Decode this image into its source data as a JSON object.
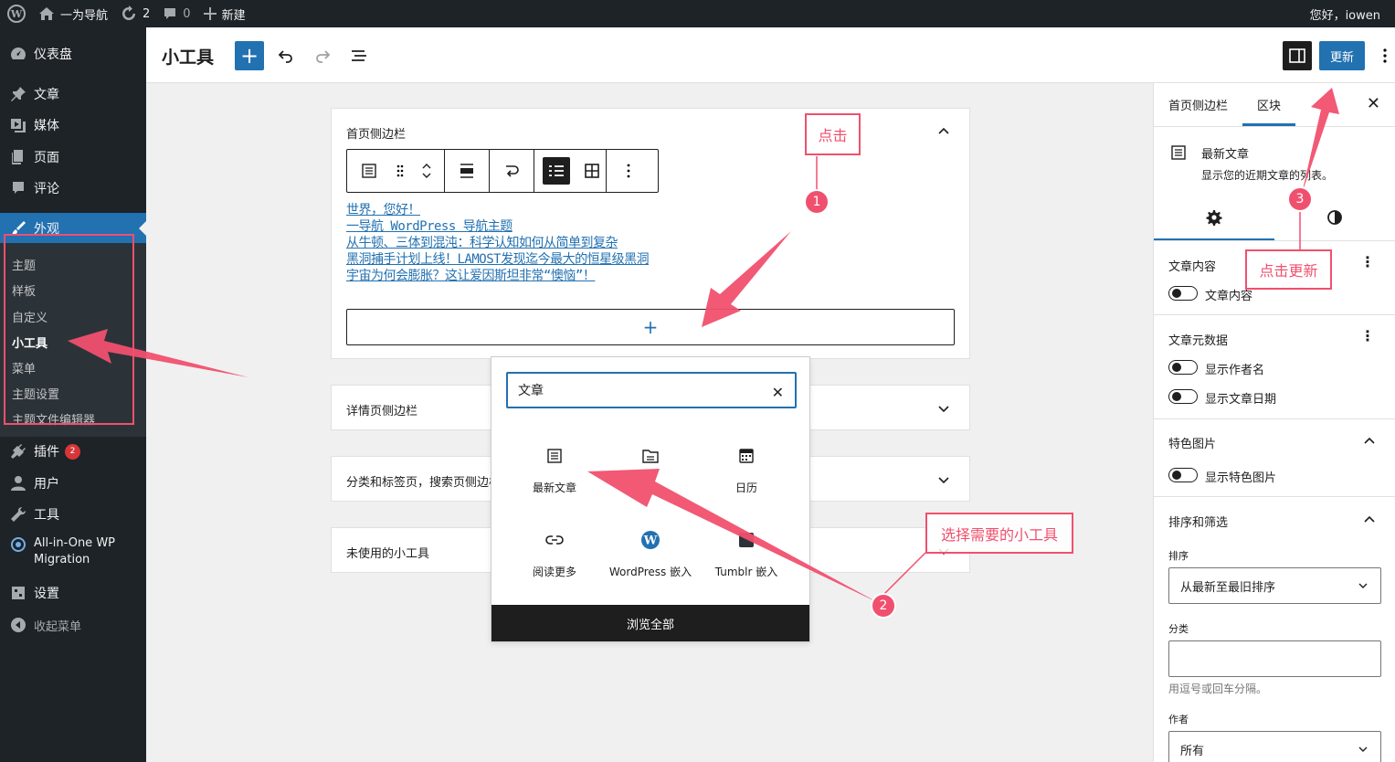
{
  "adminbar": {
    "site_name": "一为导航",
    "updates_count": "2",
    "comments_count": "0",
    "new_label": "新建",
    "greeting": "您好，iowen"
  },
  "menu": {
    "dashboard": "仪表盘",
    "posts": "文章",
    "media": "媒体",
    "pages": "页面",
    "comments": "评论",
    "appearance": "外观",
    "submenu": [
      "主题",
      "样板",
      "自定义",
      "小工具",
      "菜单",
      "主题设置",
      "主题文件编辑器"
    ],
    "plugins": "插件",
    "plugins_badge": "2",
    "users": "用户",
    "tools": "工具",
    "migration_line1": "All-in-One WP",
    "migration_line2": "Migration",
    "settings": "设置",
    "collapse": "收起菜单"
  },
  "header": {
    "title": "小工具",
    "update_label": "更新"
  },
  "canvas": {
    "area1_title": "首页侧边栏",
    "posts": [
      "世界，您好！",
      "一导航 WordPress 导航主题",
      "从牛顿、三体到混沌：科学认知如何从简单到复杂",
      "黑洞捕手计划上线！LAMOST发现迄今最大的恒星级黑洞",
      "宇宙为何会膨胀？这让爱因斯坦非常“懊恼”！"
    ],
    "appender_symbol": "+",
    "area2_title": "详情页侧边栏",
    "area3_title": "分类和标签页，搜索页侧边栏",
    "area4_title": "未使用的小工具"
  },
  "inserter": {
    "search_value": "文章",
    "blocks": [
      {
        "label": "最新文章",
        "icon": "latest-posts-icon"
      },
      {
        "label": "",
        "icon": "archives-icon"
      },
      {
        "label": "日历",
        "icon": "calendar-icon"
      },
      {
        "label": "阅读更多",
        "icon": "link-icon"
      },
      {
        "label": "WordPress 嵌入",
        "icon": "wordpress-icon"
      },
      {
        "label": "Tumblr 嵌入",
        "icon": "tumblr-icon"
      }
    ],
    "browse_all": "浏览全部"
  },
  "settings": {
    "tab_area": "首页侧边栏",
    "tab_block": "区块",
    "block_name": "最新文章",
    "block_desc": "显示您的近期文章的列表。",
    "post_content_title": "文章内容",
    "post_content_toggle": "文章内容",
    "post_meta_title": "文章元数据",
    "show_author": "显示作者名",
    "show_date": "显示文章日期",
    "featured_title": "特色图片",
    "show_featured": "显示特色图片",
    "sorting_title": "排序和筛选",
    "order_label": "排序",
    "order_value": "从最新至最旧排序",
    "category_label": "分类",
    "category_help": "用逗号或回车分隔。",
    "author_label": "作者",
    "author_value": "所有"
  },
  "annotations": {
    "click_label": "点击",
    "choose_label": "选择需要的小工具",
    "update_label": "点击更新",
    "step1": "1",
    "step2": "2",
    "step3": "3",
    "color": "#f0506e"
  }
}
